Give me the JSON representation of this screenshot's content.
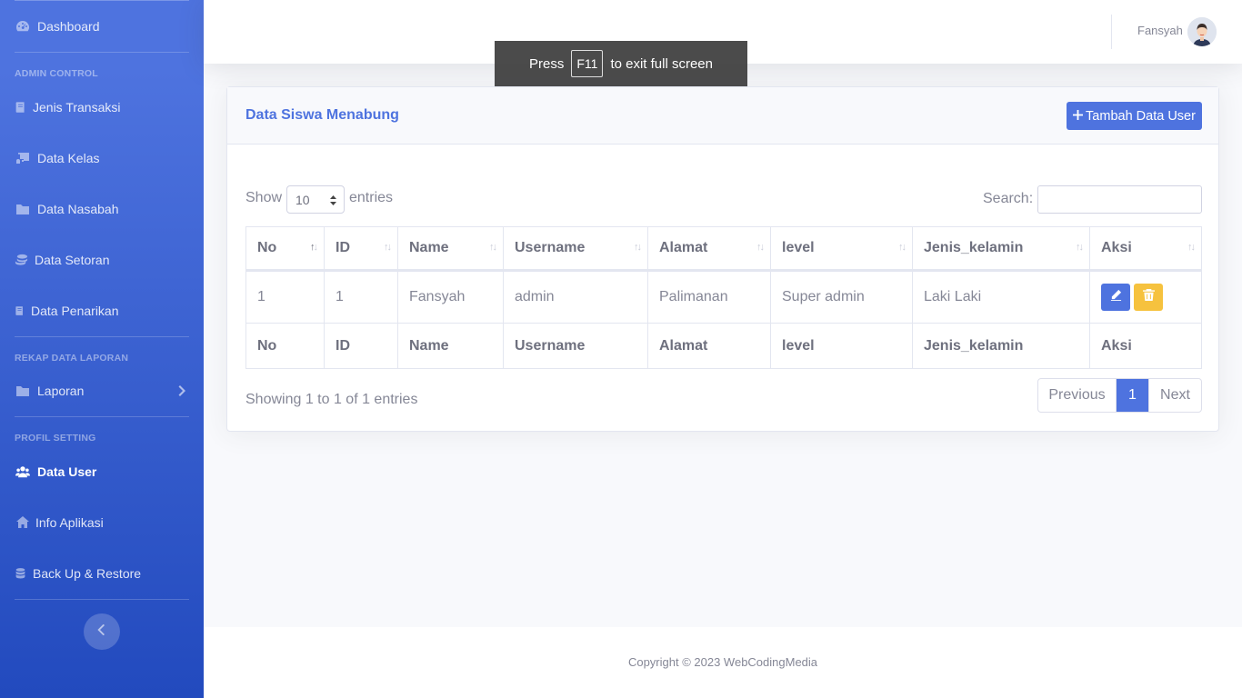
{
  "sidebar": {
    "dashboard": "Dashboard",
    "heading_admin": "ADMIN CONTROL",
    "jenis_transaksi": "Jenis Transaksi",
    "data_kelas": "Data Kelas",
    "data_nasabah": "Data Nasabah",
    "data_setoran": "Data Setoran",
    "data_penarikan": "Data Penarikan",
    "heading_rekap": "REKAP DATA LAPORAN",
    "laporan": "Laporan",
    "heading_profil": "PROFIL SETTING",
    "data_user": "Data User",
    "info_aplikasi": "Info Aplikasi",
    "backup": "Back Up & Restore"
  },
  "topbar": {
    "user_name": "Fansyah"
  },
  "fullscreen_notice": {
    "press": "Press",
    "key": "F11",
    "rest": "to exit full screen"
  },
  "card": {
    "title": "Data Siswa Menabung",
    "add_button": "Tambah Data User"
  },
  "controls": {
    "show": "Show",
    "page_length": "10",
    "entries": "entries",
    "search_label": "Search:"
  },
  "table": {
    "headers": [
      "No",
      "ID",
      "Name",
      "Username",
      "Alamat",
      "level",
      "Jenis_kelamin",
      "Aksi"
    ],
    "rows": [
      [
        "1",
        "1",
        "Fansyah",
        "admin",
        "Palimanan",
        "Super admin",
        "Laki Laki"
      ]
    ]
  },
  "info": "Showing 1 to 1 of 1 entries",
  "pagination": {
    "previous": "Previous",
    "current": "1",
    "next": "Next"
  },
  "footer": {
    "copyright": "Copyright © 2023 WebCodingMedia"
  },
  "colors": {
    "primary": "#4e73df",
    "warning": "#f6c23e",
    "sidebar_gradient_end": "#224abe"
  }
}
